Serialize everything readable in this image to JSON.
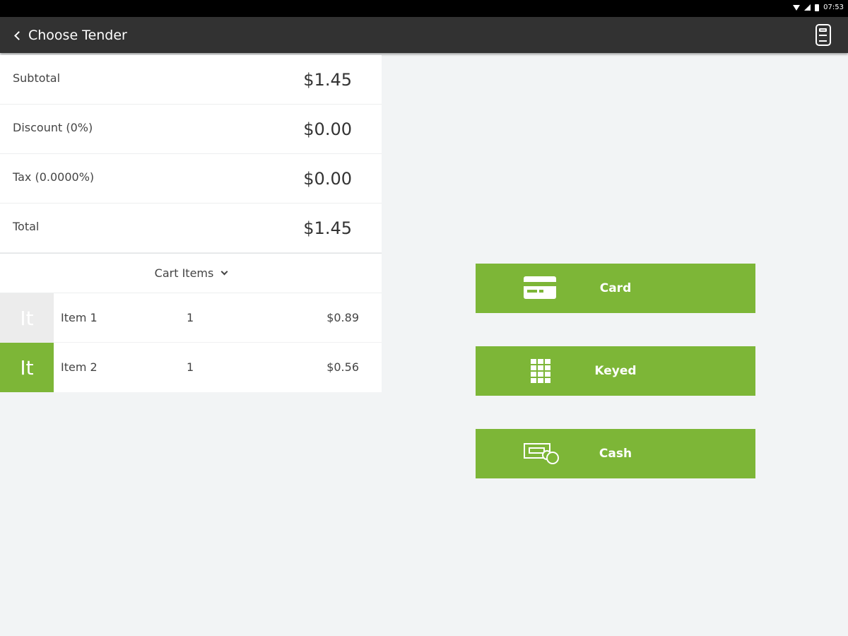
{
  "status_bar": {
    "time": "07:53",
    "icons": [
      "wifi-icon",
      "signal-icon",
      "battery-icon"
    ]
  },
  "toolbar": {
    "title": "Choose Tender",
    "back_icon": "chevron-left-icon",
    "right_icon": "card-reader-icon",
    "background": "#323232"
  },
  "totals": {
    "subtotal": {
      "label": "Subtotal",
      "value": "$1.45"
    },
    "discount": {
      "label": "Discount (0%)",
      "value": "$0.00"
    },
    "tax": {
      "label": "Tax (0.0000%)",
      "value": "$0.00"
    },
    "total": {
      "label": "Total",
      "value": "$1.45"
    }
  },
  "cart": {
    "header_label": "Cart Items",
    "header_icon": "chevron-down-icon",
    "items": [
      {
        "thumb": "It",
        "name": "Item 1",
        "qty": "1",
        "price": "$0.89",
        "thumb_color": "#ececec"
      },
      {
        "thumb": "It",
        "name": "Item 2",
        "qty": "1",
        "price": "$0.56",
        "thumb_color": "#7db637"
      }
    ]
  },
  "tenders": [
    {
      "label": "Card",
      "icon": "credit-card-icon"
    },
    {
      "label": "Keyed",
      "icon": "keypad-icon"
    },
    {
      "label": "Cash",
      "icon": "cash-icon"
    }
  ],
  "colors": {
    "accent": "#7db637",
    "toolbar": "#323232",
    "background": "#f2f4f5"
  }
}
